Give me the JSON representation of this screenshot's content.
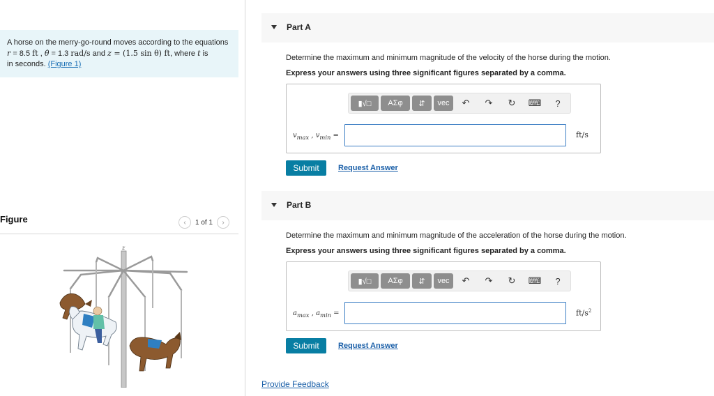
{
  "problem": {
    "text_intro": "A horse on the merry-go-round moves according to the equations",
    "r_sym": "r",
    "eq1": " = 8.5 ",
    "unit_ft": "ft",
    "sep1": " , ",
    "theta_dot": "θ̇",
    "eq2": " = 1.3 ",
    "unit_rads": "rad/s",
    "and_word": " and ",
    "z_sym": "z",
    "eq3": " = (1.5 sin θ) ft",
    "where_text": ", where ",
    "t_sym": "t",
    "is_text": " is",
    "line3": "in seconds. ",
    "figure_link": "(Figure 1)"
  },
  "figure": {
    "title": "Figure",
    "pager_text": "1 of 1",
    "prev_icon": "chevron-left-icon",
    "next_icon": "chevron-right-icon",
    "axis_label": "z"
  },
  "toolbar": {
    "templates": "▮√□",
    "greek": "ΑΣφ",
    "arrows": "⇵",
    "vec": "vec",
    "undo": "↶",
    "redo": "↷",
    "reset": "↻",
    "keyboard": "⌨",
    "help": "?"
  },
  "partA": {
    "title": "Part A",
    "question": "Determine the maximum and minimum magnitude of the velocity of the horse during the motion.",
    "instruction": "Express your answers using three significant figures separated by a comma.",
    "label_v1": "v",
    "label_sub1": "max",
    "label_sep": " , ",
    "label_v2": "v",
    "label_sub2": "min",
    "label_eq": " =",
    "value": "",
    "unit": "ft/s",
    "submit": "Submit",
    "request": "Request Answer"
  },
  "partB": {
    "title": "Part B",
    "question": "Determine the maximum and minimum magnitude of the acceleration of the horse during the motion.",
    "instruction": "Express your answers using three significant figures separated by a comma.",
    "label_v1": "a",
    "label_sub1": "max",
    "label_sep": " , ",
    "label_v2": "a",
    "label_sub2": "min",
    "label_eq": " =",
    "value": "",
    "unit_base": "ft/s",
    "unit_exp": "2",
    "submit": "Submit",
    "request": "Request Answer"
  },
  "feedback": "Provide Feedback",
  "colors": {
    "problem_bg": "#e8f5f9",
    "link": "#1a5fa8",
    "submit_bg": "#087ea3",
    "input_border": "#3b7dc4",
    "toolbar_btn": "#8e8e8e"
  }
}
